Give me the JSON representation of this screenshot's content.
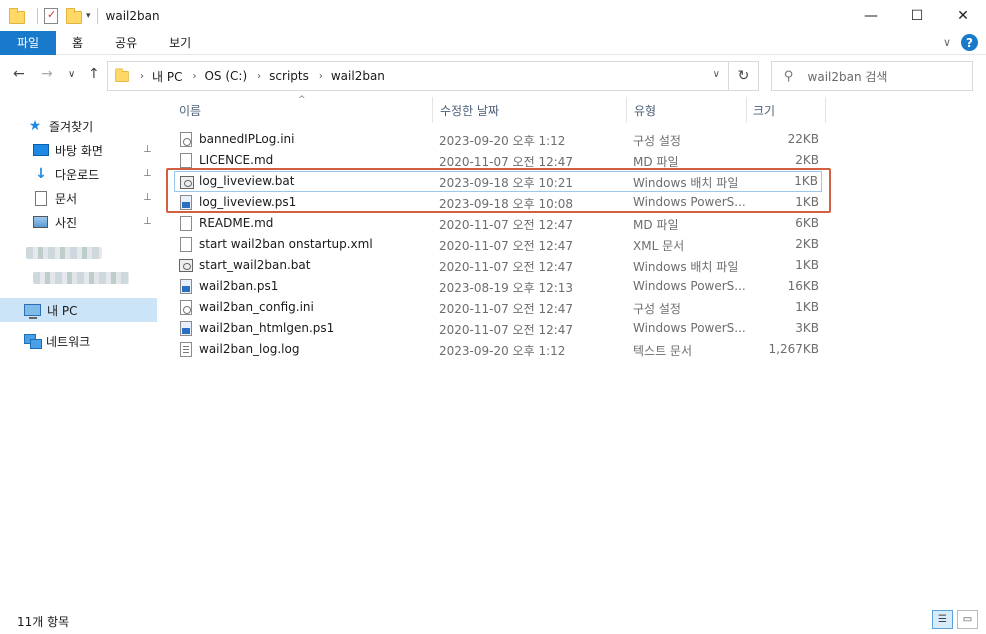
{
  "window": {
    "title": "wail2ban",
    "controls": {
      "minimize": "—",
      "maximize": "☐",
      "close": "✕"
    }
  },
  "ribbon": {
    "tabs": [
      "파일",
      "홈",
      "공유",
      "보기"
    ],
    "collapse_glyph": "∨",
    "help_glyph": "?"
  },
  "address": {
    "back": "←",
    "forward": "→",
    "recent": "∨",
    "up": "↑",
    "breadcrumbs": [
      "내 PC",
      "OS (C:)",
      "scripts",
      "wail2ban"
    ],
    "dropdown": "∨",
    "refresh": "↻",
    "search_placeholder": "wail2ban 검색"
  },
  "sidebar": {
    "quick_access": "즐겨찾기",
    "items": [
      {
        "label": "바탕 화면",
        "icon": "desktop-icon",
        "pinned": true
      },
      {
        "label": "다운로드",
        "icon": "download-icon",
        "pinned": true
      },
      {
        "label": "문서",
        "icon": "documents-icon",
        "pinned": true
      },
      {
        "label": "사진",
        "icon": "pictures-icon",
        "pinned": true
      }
    ],
    "this_pc": "내 PC",
    "network": "네트워크",
    "pin_glyph": "📌"
  },
  "columns": {
    "name": "이름",
    "date": "수정한 날짜",
    "type": "유형",
    "size": "크기"
  },
  "files": [
    {
      "name": "bannedIPLog.ini",
      "date": "2023-09-20 오후 1:12",
      "type": "구성 설정",
      "size": "22KB",
      "icon": "config-file-icon"
    },
    {
      "name": "LICENCE.md",
      "date": "2020-11-07 오전 12:47",
      "type": "MD 파일",
      "size": "2KB",
      "icon": "file-icon"
    },
    {
      "name": "log_liveview.bat",
      "date": "2023-09-18 오후 10:21",
      "type": "Windows 배치 파일",
      "size": "1KB",
      "icon": "batch-file-icon"
    },
    {
      "name": "log_liveview.ps1",
      "date": "2023-09-18 오후 10:08",
      "type": "Windows PowerS...",
      "size": "1KB",
      "icon": "powershell-file-icon"
    },
    {
      "name": "README.md",
      "date": "2020-11-07 오전 12:47",
      "type": "MD 파일",
      "size": "6KB",
      "icon": "file-icon"
    },
    {
      "name": "start wail2ban onstartup.xml",
      "date": "2020-11-07 오전 12:47",
      "type": "XML 문서",
      "size": "2KB",
      "icon": "file-icon"
    },
    {
      "name": "start_wail2ban.bat",
      "date": "2020-11-07 오전 12:47",
      "type": "Windows 배치 파일",
      "size": "1KB",
      "icon": "batch-file-icon"
    },
    {
      "name": "wail2ban.ps1",
      "date": "2023-08-19 오후 12:13",
      "type": "Windows PowerS...",
      "size": "16KB",
      "icon": "powershell-file-icon"
    },
    {
      "name": "wail2ban_config.ini",
      "date": "2020-11-07 오전 12:47",
      "type": "구성 설정",
      "size": "1KB",
      "icon": "config-file-icon"
    },
    {
      "name": "wail2ban_htmlgen.ps1",
      "date": "2020-11-07 오전 12:47",
      "type": "Windows PowerS...",
      "size": "3KB",
      "icon": "powershell-file-icon"
    },
    {
      "name": "wail2ban_log.log",
      "date": "2023-09-20 오후 1:12",
      "type": "텍스트 문서",
      "size": "1,267KB",
      "icon": "text-file-icon"
    }
  ],
  "status": {
    "count": "11개 항목"
  },
  "colors": {
    "accent": "#1979ca",
    "highlight_border": "#d0603f",
    "selection": "#cce4f7"
  }
}
